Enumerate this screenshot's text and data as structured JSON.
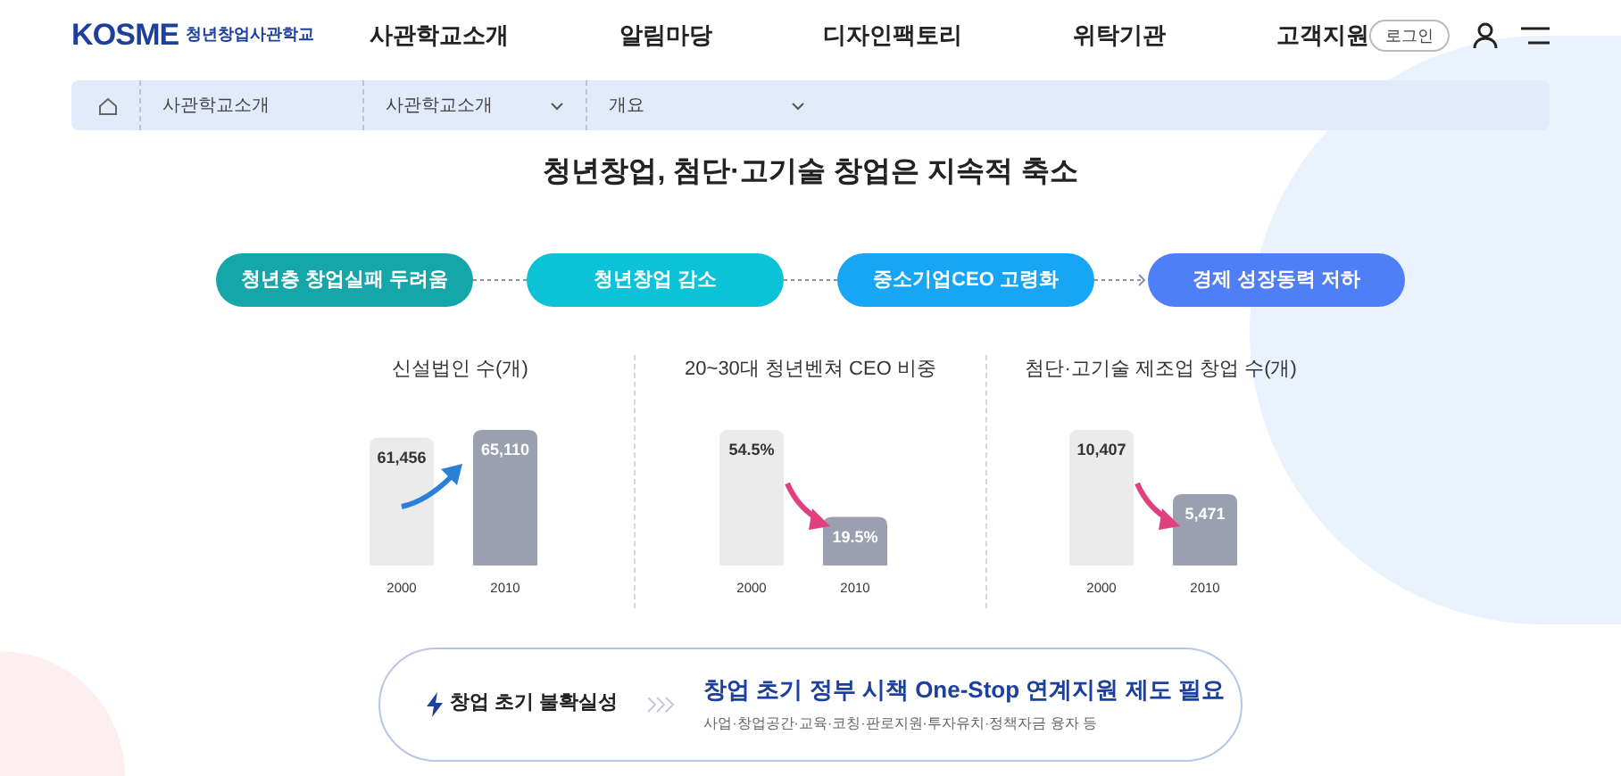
{
  "header": {
    "logo": "KOSME",
    "logo_sub": "청년창업사관학교",
    "nav": [
      {
        "label": "사관학교소개"
      },
      {
        "label": "알림마당"
      },
      {
        "label": "디자인팩토리"
      },
      {
        "label": "위탁기관"
      },
      {
        "label": "고객지원"
      }
    ],
    "login": "로그인"
  },
  "breadcrumb": [
    {
      "label": "사관학교소개",
      "dropdown": false
    },
    {
      "label": "사관학교소개",
      "dropdown": true
    },
    {
      "label": "개요",
      "dropdown": true
    }
  ],
  "title": "청년창업, 첨단·고기술 창업은 지속적 축소",
  "steps": [
    {
      "label": "청년층 창업실패 두려움",
      "color": "#14a6a8"
    },
    {
      "label": "청년창업 감소",
      "color": "#0cc2d7"
    },
    {
      "label": "중소기업CEO 고령화",
      "color": "#17a6f5"
    },
    {
      "label": "경제 성장동력 저하",
      "color": "#4f7ff7"
    }
  ],
  "charts": [
    {
      "chart_data": {
        "type": "bar",
        "title": "신설법인 수(개)",
        "categories": [
          "2000",
          "2010"
        ],
        "values": [
          61456,
          65110
        ],
        "data_labels": true,
        "value_labels": [
          "61,456",
          "65,110"
        ]
      }
    },
    {
      "chart_data": {
        "type": "bar",
        "title": "20~30대 청년벤쳐 CEO 비중",
        "categories": [
          "2000",
          "2010"
        ],
        "values": [
          54.5,
          19.5
        ],
        "data_labels": true,
        "value_labels": [
          "54.5%",
          "19.5%"
        ]
      }
    },
    {
      "chart_data": {
        "type": "bar",
        "title": "첨단·고기술 제조업 창업 수(개)",
        "categories": [
          "2000",
          "2010"
        ],
        "values": [
          10407,
          5471
        ],
        "data_labels": true,
        "value_labels": [
          "10,407",
          "5,471"
        ]
      }
    }
  ],
  "summary": {
    "problem": "창업 초기 불확실성",
    "solution": "창업 초기 정부 시책 One-Stop 연계지원 제도 필요",
    "detail": "사업·창업공간·교육·코칭·판로지원·투자유치·정책자금 융자 등"
  }
}
